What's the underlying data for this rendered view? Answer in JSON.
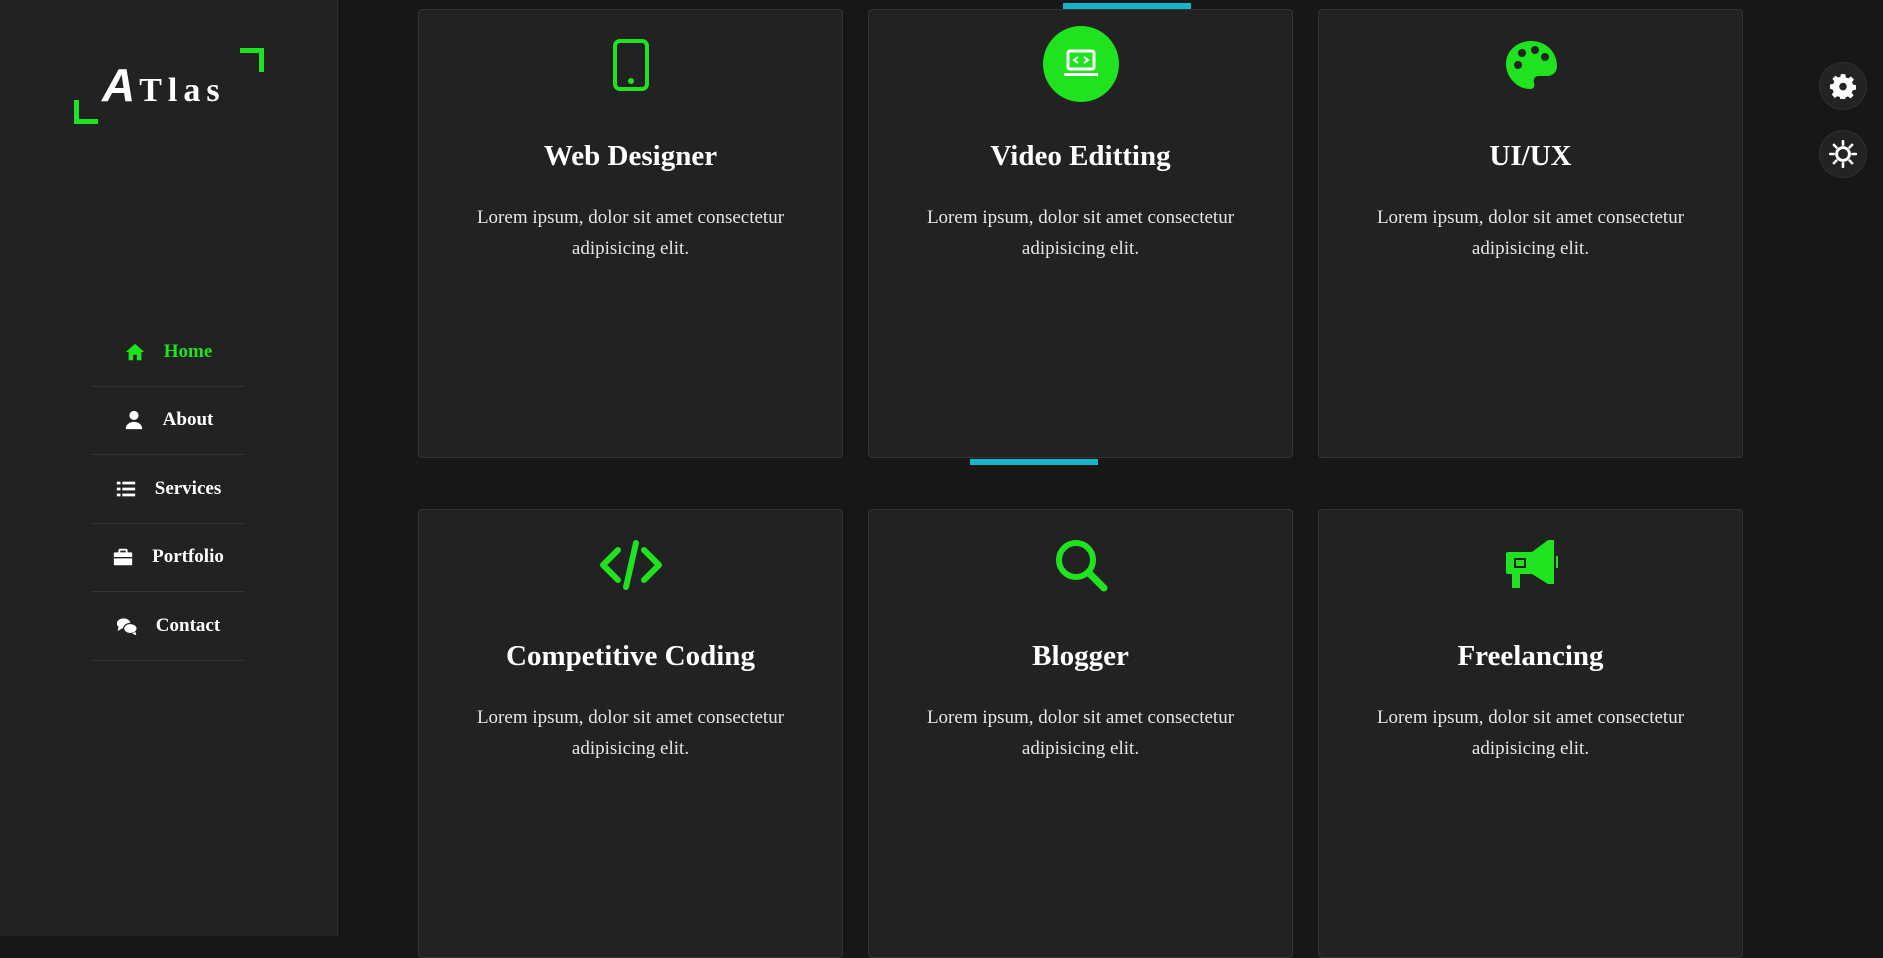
{
  "brand": {
    "logo_letter": "A",
    "logo_rest": "Tlas"
  },
  "nav": [
    {
      "label": "Home",
      "icon": "home-icon",
      "active": true
    },
    {
      "label": "About",
      "icon": "user-icon",
      "active": false
    },
    {
      "label": "Services",
      "icon": "list-icon",
      "active": false
    },
    {
      "label": "Portfolio",
      "icon": "briefcase-icon",
      "active": false
    },
    {
      "label": "Contact",
      "icon": "chat-icon",
      "active": false
    }
  ],
  "services": [
    {
      "title": "Web Designer",
      "desc": "Lorem ipsum, dolor sit amet consectetur adipisicing elit.",
      "icon": "mobile-icon"
    },
    {
      "title": "Video Editting",
      "desc": "Lorem ipsum, dolor sit amet consectetur adipisicing elit.",
      "icon": "laptop-code-icon"
    },
    {
      "title": "UI/UX",
      "desc": "Lorem ipsum, dolor sit amet consectetur adipisicing elit.",
      "icon": "palette-icon"
    },
    {
      "title": "Competitive Coding",
      "desc": "Lorem ipsum, dolor sit amet consectetur adipisicing elit.",
      "icon": "code-icon"
    },
    {
      "title": "Blogger",
      "desc": "Lorem ipsum, dolor sit amet consectetur adipisicing elit.",
      "icon": "search-icon"
    },
    {
      "title": "Freelancing",
      "desc": "Lorem ipsum, dolor sit amet consectetur adipisicing elit.",
      "icon": "megaphone-icon"
    }
  ],
  "colors": {
    "accent": "#1ee31e",
    "highlight": "#17b3c9",
    "background": "#171717",
    "panel": "#222222"
  },
  "floating_buttons": [
    {
      "icon": "gear-icon"
    },
    {
      "icon": "sun-icon"
    }
  ]
}
